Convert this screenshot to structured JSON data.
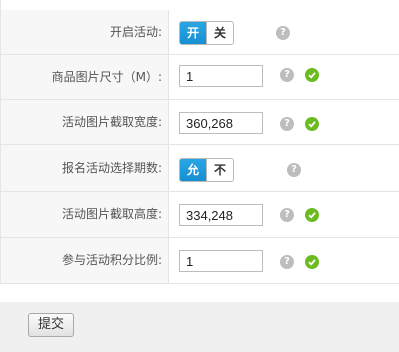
{
  "form": {
    "rows": [
      {
        "label": "开启活动:",
        "type": "toggle",
        "options": [
          "开启",
          "关闭"
        ],
        "selected": "开启"
      },
      {
        "label": "商品图片尺寸（M）:",
        "type": "text",
        "value": "1"
      },
      {
        "label": "活动图片截取宽度:",
        "type": "text",
        "value": "360,268"
      },
      {
        "label": "报名活动选择期数:",
        "type": "toggle",
        "options": [
          "允许",
          "不允许"
        ],
        "selected": "允许"
      },
      {
        "label": "活动图片截取高度:",
        "type": "text",
        "value": "334,248"
      },
      {
        "label": "参与活动积分比例:",
        "type": "text",
        "value": "1"
      }
    ],
    "help_glyph": "?",
    "help_icon": "question-circle-icon",
    "valid_icon": "check-circle-icon"
  },
  "footer": {
    "submit_label": "提交"
  },
  "colors": {
    "toggle_active": "#1a95d8",
    "valid": "#6cbb23",
    "help": "#bdbdbd"
  }
}
